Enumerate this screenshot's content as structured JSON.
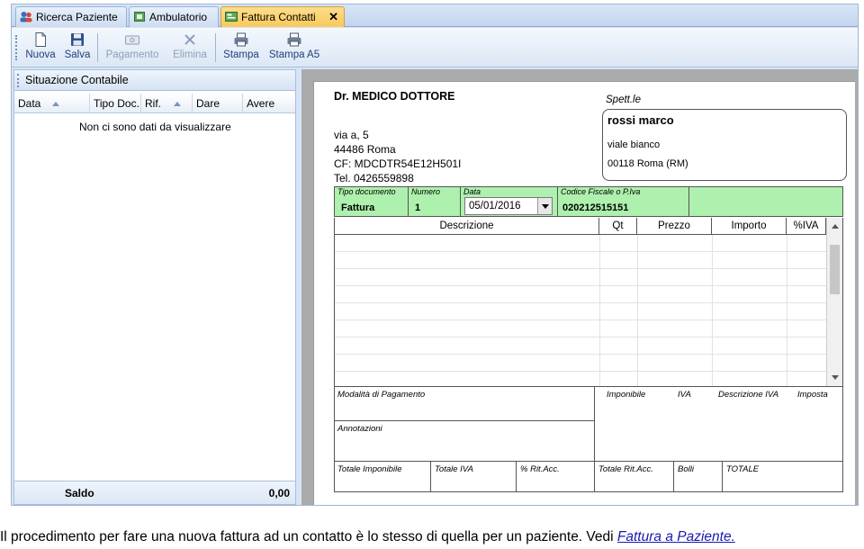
{
  "tabs": [
    {
      "label": "Ricerca Paziente",
      "icon": "people-icon"
    },
    {
      "label": "Ambulatorio",
      "icon": "clinic-icon"
    },
    {
      "label": "Fattura Contatti",
      "icon": "invoice-icon",
      "active": true,
      "close": "✕"
    }
  ],
  "toolbar": {
    "nuova": "Nuova",
    "salva": "Salva",
    "pagamento": "Pagamento",
    "elimina": "Elimina",
    "stampa": "Stampa",
    "stampa_a5": "Stampa A5"
  },
  "left_panel": {
    "title": "Situazione Contabile",
    "columns": [
      "Data",
      "Tipo Doc.",
      "Rif.",
      "Dare",
      "Avere"
    ],
    "empty_text": "Non ci sono dati da visualizzare",
    "footer_label": "Saldo",
    "footer_value": "0,00"
  },
  "invoice": {
    "doctor_name": "Dr. MEDICO DOTTORE",
    "address_line1": "via a, 5",
    "address_line2": "44486 Roma",
    "cf": "CF: MDCDTR54E12H501I",
    "tel": "Tel. 0426559898",
    "spett_label": "Spett.le",
    "recipient_name": "rossi marco",
    "recipient_street": "viale bianco",
    "recipient_city": "00118 Roma (RM)",
    "tipo_doc_label": "Tipo documento",
    "tipo_doc_value": "Fattura",
    "numero_label": "Numero",
    "numero_value": "1",
    "data_label": "Data",
    "data_value": "05/01/2016",
    "cf_piva_label": "Codice Fiscale o P.Iva",
    "cf_piva_value": "020212515151",
    "grid_columns": [
      "Descrizione",
      "Qt",
      "Prezzo",
      "Importo",
      "%IVA"
    ],
    "modalita_label": "Modalità di Pagamento",
    "annotazioni_label": "Annotazioni",
    "imponibile_label": "Imponibile",
    "iva_label": "IVA",
    "descr_iva_label": "Descrizione IVA",
    "imposta_label": "Imposta",
    "tot_imponibile_label": "Totale Imponibile",
    "tot_iva_label": "Totale IVA",
    "rit_acc_label": "% Rit.Acc.",
    "tot_rit_acc_label": "Totale Rit.Acc.",
    "bolli_label": "Bolli",
    "totale_label": "TOTALE"
  },
  "caption": {
    "text": "Il procedimento per fare una nuova fattura ad un contatto è lo stesso di quella per un paziente. Vedi ",
    "link": "Fattura a Paziente."
  },
  "colors": {
    "green_band": "#aef0ae",
    "active_tab": "#f9c95c",
    "frame_blue": "#d6e5f6"
  }
}
